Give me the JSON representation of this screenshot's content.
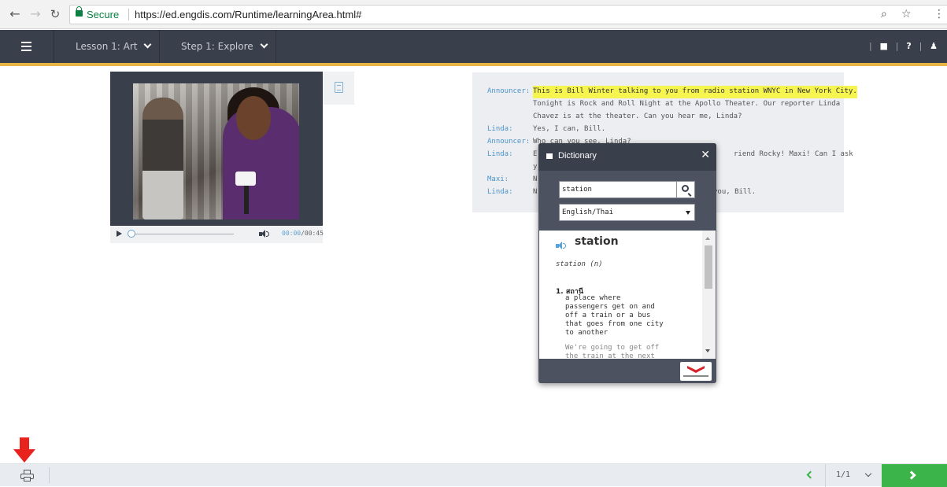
{
  "browser": {
    "secure_label": "Secure",
    "url": "https://ed.engdis.com/Runtime/learningArea.html#",
    "icons": [
      "back-icon",
      "forward-icon",
      "reload-icon",
      "lock-icon",
      "zoom-icon",
      "star-icon",
      "more-icon"
    ]
  },
  "header": {
    "lesson_label": "Lesson 1: Art",
    "step_label": "Step 1: Explore",
    "icons": [
      "menu-icon",
      "dictionary-icon",
      "help-icon",
      "user-icon"
    ],
    "colors": {
      "bar": "#3a3f4c",
      "accent": "#e8b443"
    }
  },
  "player": {
    "current_time": "00:00",
    "total_time": "/00:45",
    "progress": 0
  },
  "transcript": {
    "lines": [
      {
        "speaker": "Announcer:",
        "text": "This is Bill Winter talking to you from radio station WNYC in New York City.",
        "highlighted": true
      },
      {
        "speaker": "",
        "text": "Tonight is Rock and Roll Night at the Apollo Theater. Our reporter Linda"
      },
      {
        "speaker": "",
        "text": "Chavez is at the theater. Can you hear me, Linda?"
      },
      {
        "speaker": "Linda:",
        "text": "Yes, I can, Bill."
      },
      {
        "speaker": "Announcer:",
        "text": "Who can you see, Linda?"
      },
      {
        "speaker": "Linda:",
        "text": "E",
        "text_right": "riend Rocky! Maxi! Can I ask"
      },
      {
        "speaker": "",
        "text": "y"
      },
      {
        "speaker": "Maxi:",
        "text": "N"
      },
      {
        "speaker": "Linda:",
        "text": "N",
        "text_right": "you, Bill."
      }
    ],
    "colors": {
      "speaker": "#4a94c9",
      "highlight": "#f6f54f"
    }
  },
  "dictionary": {
    "title": "Dictionary",
    "close": "✕",
    "search_value": "station",
    "language": "English/Thai",
    "headword": "station",
    "part_of_speech": "station (n)",
    "sense_number": "1.",
    "sense_translation": "สถานี",
    "definition": "a place where passengers get on and off a train or a bus that goes from one city to another",
    "example": "We're going to get off the train at the next"
  },
  "footer": {
    "page_indicator": "1/1",
    "colors": {
      "next": "#3bb54a",
      "annotation_arrow": "#e8231e"
    }
  }
}
